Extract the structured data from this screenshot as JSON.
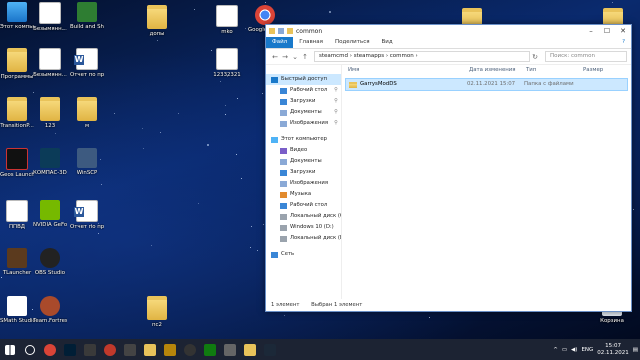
{
  "desktop": {
    "icons": [
      {
        "label": "Этот компьютер",
        "kind": "pc"
      },
      {
        "label": "Безымянн...",
        "kind": "doc"
      },
      {
        "label": "Build and Shoot L...",
        "kind": "app_bs"
      },
      {
        "label": "допы",
        "kind": "folder"
      },
      {
        "label": "mko",
        "kind": "doc"
      },
      {
        "label": "Google Chrome",
        "kind": "chrome"
      },
      {
        "label": "Программы",
        "kind": "folder"
      },
      {
        "label": "Безымянн...",
        "kind": "doc"
      },
      {
        "label": "Отчет по практике",
        "kind": "word"
      },
      {
        "label": "12332321",
        "kind": "doc"
      },
      {
        "label": "TransitionP...",
        "kind": "folder"
      },
      {
        "label": "123",
        "kind": "folder"
      },
      {
        "label": "м",
        "kind": "folder"
      },
      {
        "label": "Geos Launcher",
        "kind": "app_geos"
      },
      {
        "label": "КОМПАС-3D V19.7 учебн...",
        "kind": "app_kompas"
      },
      {
        "label": "WinSCP",
        "kind": "app_winscp"
      },
      {
        "label": "ППВД",
        "kind": "doc"
      },
      {
        "label": "NVIDIA GeFor...",
        "kind": "app_nvidia"
      },
      {
        "label": "Отчет по практике",
        "kind": "word"
      },
      {
        "label": "TLauncher",
        "kind": "app_tl"
      },
      {
        "label": "OBS Studio",
        "kind": "app_obs"
      },
      {
        "label": "SMath Studio Desktop",
        "kind": "app_smath"
      },
      {
        "label": "Team Fortress 2",
        "kind": "app_tf2"
      },
      {
        "label": "пс2",
        "kind": "folder"
      },
      {
        "label": "Корзина",
        "kind": "bin"
      }
    ],
    "top_right_icons": [
      "folder",
      "folder"
    ]
  },
  "explorer": {
    "title": "common",
    "ribbon_tabs": [
      "Файл",
      "Главная",
      "Поделиться",
      "Вид"
    ],
    "path": [
      "steamcmd",
      "steamapps",
      "common"
    ],
    "search_placeholder": "Поиск: common",
    "nav": [
      {
        "label": "Быстрый доступ",
        "icon": "star",
        "selected": true
      },
      {
        "label": "Рабочий стол",
        "icon": "desktop",
        "pinned": true
      },
      {
        "label": "Загрузки",
        "icon": "download",
        "pinned": true
      },
      {
        "label": "Документы",
        "icon": "docs",
        "pinned": true
      },
      {
        "label": "Изображения",
        "icon": "images",
        "pinned": true
      },
      {
        "label": "Этот компьютер",
        "icon": "pc"
      },
      {
        "label": "Видео",
        "icon": "video"
      },
      {
        "label": "Документы",
        "icon": "docs"
      },
      {
        "label": "Загрузки",
        "icon": "download"
      },
      {
        "label": "Изображения",
        "icon": "images"
      },
      {
        "label": "Музыка",
        "icon": "music"
      },
      {
        "label": "Рабочий стол",
        "icon": "desktop"
      },
      {
        "label": "Локальный диск (C:)",
        "icon": "drive"
      },
      {
        "label": "Windows 10 (D:)",
        "icon": "drive"
      },
      {
        "label": "Локальный диск (E:)",
        "icon": "drive"
      },
      {
        "label": "Сеть",
        "icon": "network"
      }
    ],
    "columns": [
      "Имя",
      "Дата изменения",
      "Тип",
      "Размер"
    ],
    "files": [
      {
        "name": "GarrysModDS",
        "date": "02.11.2021 15:07",
        "type": "Папка с файлами",
        "size": ""
      }
    ],
    "status_count": "1 элемент",
    "status_selected": "Выбран 1 элемент"
  },
  "taskbar": {
    "apps": [
      "start",
      "search",
      "chrome",
      "photoshop",
      "file-explorer",
      "obs-record",
      "vm",
      "explorer",
      "wow",
      "obs",
      "xbox",
      "steam-mod",
      "folder",
      "steam"
    ],
    "lang": "ENG",
    "time": "15:07",
    "date": "02.11.2021"
  },
  "colors": {
    "accent": "#1979ca",
    "selection": "#cce8ff",
    "taskbar": "#1c2333"
  }
}
